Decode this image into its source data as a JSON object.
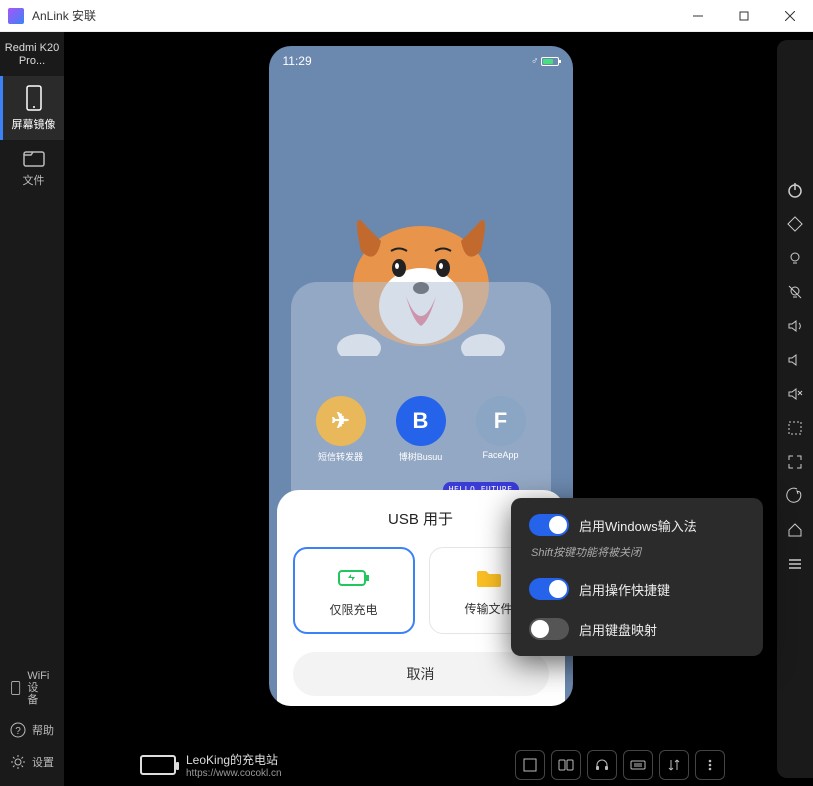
{
  "window": {
    "title": "AnLink 安联"
  },
  "device": {
    "name": "Redmi K20 Pro..."
  },
  "nav": {
    "mirror": "屏幕镜像",
    "files": "文件",
    "wifi": "WiFi设\n备",
    "help": "帮助",
    "settings": "设置"
  },
  "phone": {
    "time": "11:29",
    "apps": [
      {
        "label": "短信转发器",
        "bg": "#e8b85a",
        "letter": "✈"
      },
      {
        "label": "博树Busuu",
        "bg": "#2563eb",
        "letter": "B"
      },
      {
        "label": "FaceApp",
        "bg": "#8aa6c4",
        "letter": "F"
      }
    ],
    "pill": "HELLO FUTURE"
  },
  "sheet": {
    "title": "USB 用于",
    "opts": [
      {
        "label": "仅限充电",
        "selected": true
      },
      {
        "label": "传输文件",
        "selected": false
      }
    ],
    "cancel": "取消"
  },
  "popover": {
    "ime_label": "启用Windows输入法",
    "ime_hint": "Shift按键功能将被关闭",
    "shortcut_label": "启用操作快捷键",
    "keymap_label": "启用键盘映射",
    "ime_on": true,
    "shortcut_on": true,
    "keymap_on": false
  },
  "footer": {
    "station": "LeoKing的充电站",
    "url": "https://www.cocokl.cn"
  }
}
